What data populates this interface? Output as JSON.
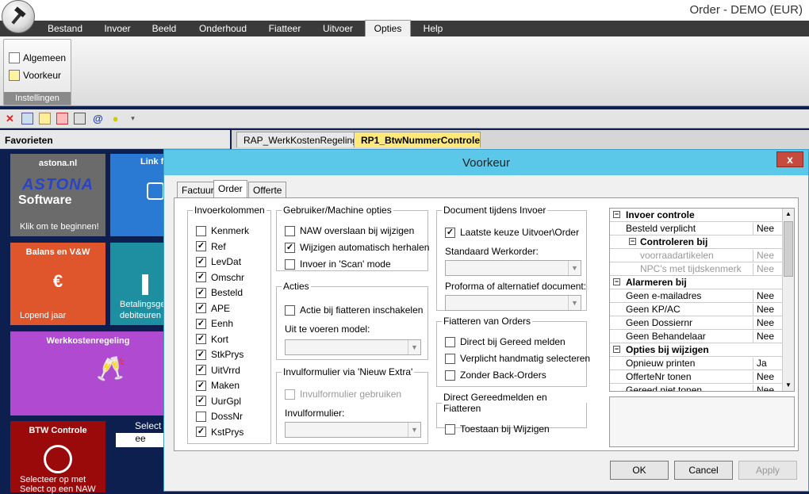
{
  "window": {
    "title": "Order - DEMO (EUR)"
  },
  "menu": [
    "Bestand",
    "Invoer",
    "Beeld",
    "Onderhoud",
    "Fiatteer",
    "Uitvoer",
    "Opties",
    "Help"
  ],
  "ribbon": {
    "items": [
      "Algemeen",
      "Voorkeur"
    ],
    "group": "Instellingen"
  },
  "favorites": {
    "header": "Favorieten"
  },
  "doc_tabs": [
    "RAP_WerkKostenRegeling",
    "RP1_BtwNummerControle"
  ],
  "tiles": {
    "astona": "astona.nl",
    "astona_logo": "ASTONA",
    "astona_sub": "Software",
    "astona_cta": "Klik om te beginnen!",
    "link": "Link f",
    "balans": "Balans en V&W",
    "euro": "€",
    "lopend": "Lopend jaar",
    "betaling1": "Betalingsge",
    "betaling2": "debiteuren",
    "werkkosten": "Werkkostenregeling",
    "btw": "BTW Controle",
    "btw_sub1": "Selecteer op met",
    "btw_sub2": "Select op een NAW",
    "select_lbl": "Select",
    "select_val": "ee"
  },
  "dialog": {
    "title": "Voorkeur",
    "close": "x",
    "tabs": [
      "Factuur",
      "Order",
      "Offerte"
    ],
    "invoer": {
      "legend": "Invoerkolommen",
      "items": [
        {
          "label": "Kenmerk",
          "checked": false
        },
        {
          "label": "Ref",
          "checked": true
        },
        {
          "label": "LevDat",
          "checked": true
        },
        {
          "label": "Omschr",
          "checked": true
        },
        {
          "label": "Besteld",
          "checked": true
        },
        {
          "label": "APE",
          "checked": true
        },
        {
          "label": "Eenh",
          "checked": true
        },
        {
          "label": "Kort",
          "checked": true
        },
        {
          "label": "StkPrys",
          "checked": true
        },
        {
          "label": "UitVrrd",
          "checked": true
        },
        {
          "label": "Maken",
          "checked": true
        },
        {
          "label": "UurGpl",
          "checked": true
        },
        {
          "label": "DossNr",
          "checked": false
        },
        {
          "label": "KstPrys",
          "checked": true
        }
      ]
    },
    "gebruiker": {
      "legend": "Gebruiker/Machine opties",
      "items": [
        {
          "label": "NAW overslaan bij wijzigen",
          "checked": false
        },
        {
          "label": "Wijzigen automatisch herhalen",
          "checked": true
        },
        {
          "label": "Invoer in 'Scan' mode",
          "checked": false
        }
      ]
    },
    "acties": {
      "legend": "Acties",
      "item": "Actie bij fiatteren inschakelen",
      "model_label": "Uit te voeren model:"
    },
    "invulformulier": {
      "legend": "Invulformulier via 'Nieuw Extra'",
      "item": "Invulformulier gebruiken",
      "label": "Invulformulier:"
    },
    "document": {
      "legend": "Document tijdens Invoer",
      "item": "Laatste keuze Uitvoer\\Order",
      "werkorder": "Standaard Werkorder:",
      "proforma": "Proforma of alternatief document:"
    },
    "fiatteren": {
      "legend": "Fiatteren van Orders",
      "items": [
        "Direct bij Gereed melden",
        "Verplicht handmatig selecteren",
        "Zonder Back-Orders"
      ]
    },
    "direct": {
      "legend": "Direct Gereedmelden en Fiatteren",
      "item": "Toestaan bij Wijzigen"
    },
    "grid": [
      {
        "type": "head",
        "label": "Invoer controle",
        "tog": "−"
      },
      {
        "type": "row",
        "label": "Besteld verplicht",
        "value": "Nee"
      },
      {
        "type": "head",
        "label": "Controleren bij",
        "tog": "−",
        "indent": true
      },
      {
        "type": "dim",
        "label": "voorraadartikelen",
        "value": "Nee"
      },
      {
        "type": "dim",
        "label": "NPC's met tijdskenmerk",
        "value": "Nee"
      },
      {
        "type": "head",
        "label": "Alarmeren bij",
        "tog": "−"
      },
      {
        "type": "row",
        "label": "Geen e-mailadres",
        "value": "Nee"
      },
      {
        "type": "row",
        "label": "Geen KP/AC",
        "value": "Nee"
      },
      {
        "type": "row",
        "label": "Geen Dossiernr",
        "value": "Nee"
      },
      {
        "type": "row",
        "label": "Geen Behandelaar",
        "value": "Nee"
      },
      {
        "type": "head",
        "label": "Opties bij wijzigen",
        "tog": "−"
      },
      {
        "type": "row",
        "label": "Opnieuw printen",
        "value": "Ja"
      },
      {
        "type": "row",
        "label": "OfferteNr tonen",
        "value": "Nee"
      },
      {
        "type": "row",
        "label": "Gereed niet tonen",
        "value": "Nee"
      }
    ],
    "buttons": {
      "ok": "OK",
      "cancel": "Cancel",
      "apply": "Apply"
    }
  }
}
